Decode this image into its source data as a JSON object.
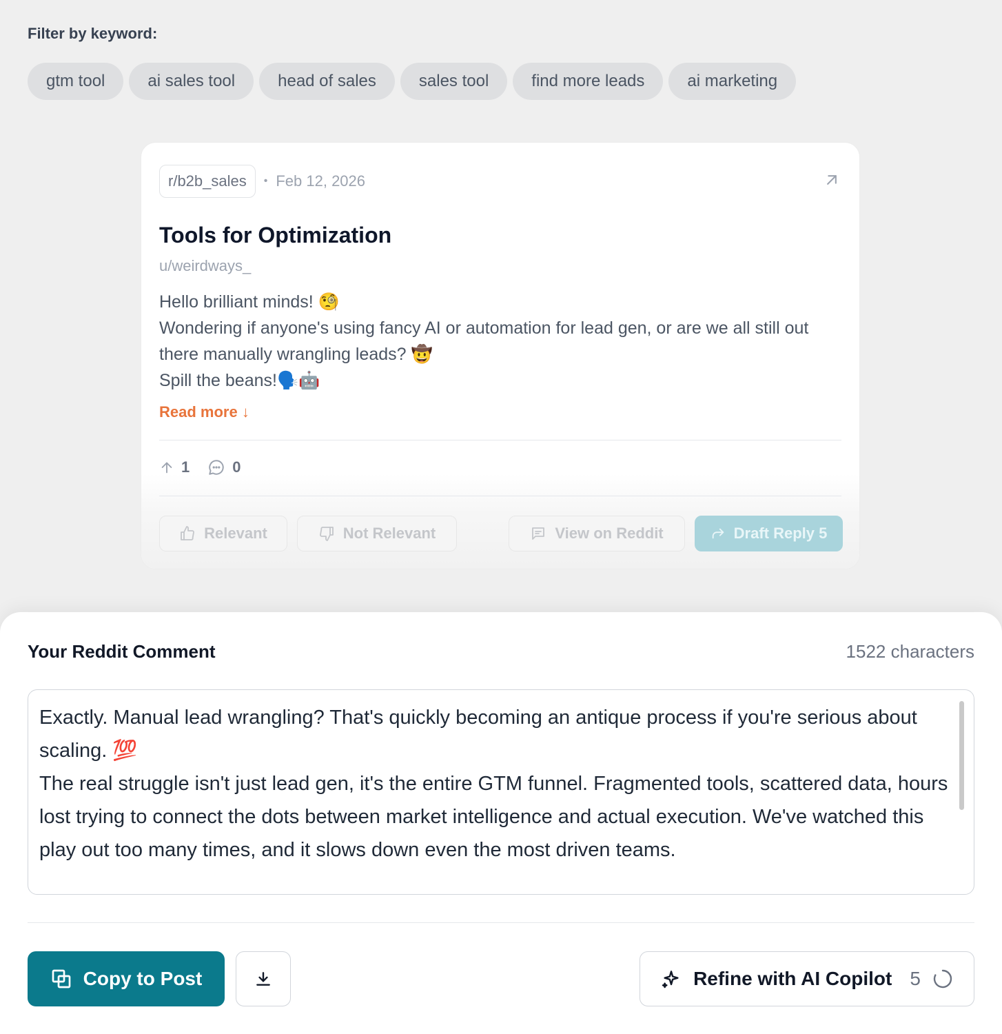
{
  "filter": {
    "label": "Filter by keyword:",
    "keywords": [
      "gtm tool",
      "ai sales tool",
      "head of sales",
      "sales tool",
      "find more leads",
      "ai marketing"
    ]
  },
  "post": {
    "subreddit": "r/b2b_sales",
    "separator": "•",
    "date": "Feb 12, 2026",
    "title": "Tools for Optimization",
    "author": "u/weirdways_",
    "body_lines": [
      "Hello brilliant minds! 🧐",
      "Wondering if anyone's using fancy AI or automation for lead gen, or are we all still out there manually wrangling leads? 🤠",
      "Spill the beans!🗣️🤖"
    ],
    "read_more": "Read more",
    "upvotes": "1",
    "comments": "0",
    "actions": {
      "relevant": "Relevant",
      "not_relevant": "Not Relevant",
      "view_on_reddit": "View on Reddit",
      "draft_reply": "Draft Reply 5"
    }
  },
  "comment_panel": {
    "title": "Your Reddit Comment",
    "char_count": "1522 characters",
    "text_lines": [
      "Exactly. Manual lead wrangling? That's quickly becoming an antique process if you're serious about scaling. 💯",
      "The real struggle isn't just lead gen, it's the entire GTM funnel. Fragmented tools, scattered data, hours lost trying to connect the dots between market intelligence and actual execution. We've watched this play out too many times, and it slows down even the most driven teams."
    ],
    "copy_label": "Copy to Post",
    "refine_label": "Refine with AI Copilot",
    "refine_count": "5"
  },
  "colors": {
    "accent": "#0b7a8c",
    "read_more": "#e8743b",
    "draft_disabled": "#a9d4dc"
  }
}
